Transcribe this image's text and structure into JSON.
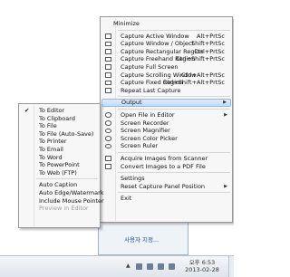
{
  "main_menu": {
    "top_item": "Minimize",
    "capture_items": [
      {
        "label": "Capture Active Window",
        "shortcut": "Alt+PrtSc",
        "icon": "window-icon"
      },
      {
        "label": "Capture Window / Object",
        "shortcut": "Shift+PrtSc",
        "icon": "window-object-icon"
      },
      {
        "label": "Capture Rectangular Region",
        "shortcut": "Ctrl+PrtSc",
        "icon": "rect-region-icon"
      },
      {
        "label": "Capture Freehand Region",
        "shortcut": "Ctrl+Shift+PrtSc",
        "icon": "freehand-region-icon"
      },
      {
        "label": "Capture Full Screen",
        "shortcut": "",
        "icon": "fullscreen-icon"
      },
      {
        "label": "Capture Scrolling Window",
        "shortcut": "Ctrl+Alt+PrtSc",
        "icon": "scrolling-window-icon"
      },
      {
        "label": "Capture Fixed Region",
        "shortcut": "Ctrl+Shift+Alt+PrtSc",
        "icon": "fixed-region-icon"
      },
      {
        "label": "Repeat Last Capture",
        "shortcut": "",
        "icon": "repeat-icon"
      }
    ],
    "output_label": "Output",
    "tool_items": [
      {
        "label": "Open File in Editor",
        "has_submenu": true,
        "icon": "open-file-icon"
      },
      {
        "label": "Screen Recorder",
        "icon": "recorder-icon"
      },
      {
        "label": "Screen Magnifier",
        "icon": "magnifier-icon"
      },
      {
        "label": "Screen Color Picker",
        "icon": "color-picker-icon"
      },
      {
        "label": "Screen Ruler",
        "icon": "ruler-icon"
      }
    ],
    "scanner_items": [
      {
        "label": "Acquire Images from Scanner",
        "icon": "scanner-icon"
      },
      {
        "label": "Convert Images to a PDF File",
        "icon": "pdf-icon"
      }
    ],
    "settings_label": "Settings",
    "reset_label": "Reset Capture Panel Position",
    "exit_label": "Exit"
  },
  "output_submenu": {
    "destinations": [
      {
        "label": "To Editor",
        "checked": true
      },
      {
        "label": "To Clipboard",
        "checked": false
      },
      {
        "label": "To File",
        "checked": false
      },
      {
        "label": "To File (Auto-Save)",
        "checked": false
      },
      {
        "label": "To Printer",
        "checked": false
      },
      {
        "label": "To Email",
        "checked": false
      },
      {
        "label": "To Word",
        "checked": false
      },
      {
        "label": "To PowerPoint",
        "checked": false
      },
      {
        "label": "To Web (FTP)",
        "checked": false
      }
    ],
    "options": [
      {
        "label": "Auto Caption",
        "disabled": false
      },
      {
        "label": "Auto Edge/Watermark",
        "disabled": false
      },
      {
        "label": "Include Mouse Pointer",
        "disabled": false
      },
      {
        "label": "Preview in Editor",
        "disabled": true
      }
    ]
  },
  "tray_popup": {
    "customize_link": "사용자 지정..."
  },
  "taskbar": {
    "time": "오후 6:53",
    "date": "2013-02-28"
  },
  "colors": {
    "menu_bg": "#f7f7f7",
    "highlight": "#c3dcf6",
    "link": "#1a4f9c"
  }
}
